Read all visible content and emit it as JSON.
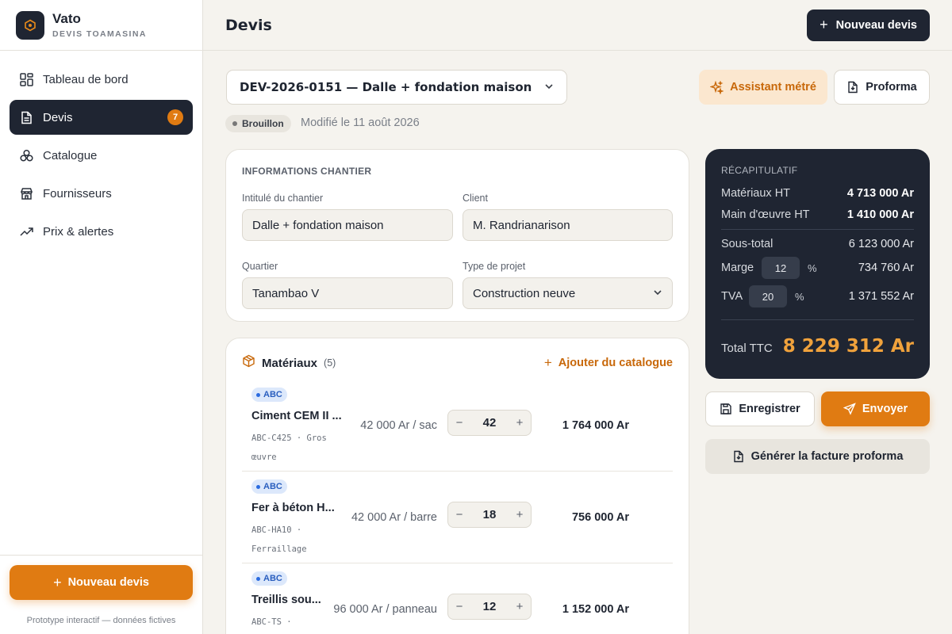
{
  "brand": {
    "name": "Vato",
    "subtitle": "DEVIS TOAMASINA"
  },
  "sidebar": {
    "items": [
      {
        "label": "Tableau de bord",
        "icon": "dashboard-icon"
      },
      {
        "label": "Devis",
        "icon": "document-icon",
        "badge": "7",
        "active": true
      },
      {
        "label": "Catalogue",
        "icon": "catalog-icon"
      },
      {
        "label": "Fournisseurs",
        "icon": "store-icon"
      },
      {
        "label": "Prix & alertes",
        "icon": "trending-up-icon"
      }
    ],
    "new_button": "Nouveau devis",
    "note": "Prototype interactif — données fictives"
  },
  "header": {
    "title": "Devis",
    "new_button": "Nouveau devis"
  },
  "devis": {
    "selected": "DEV-2026-0151 — Dalle + fondation maison",
    "assistant_button": "Assistant métré",
    "proforma_button": "Proforma",
    "status": "Brouillon",
    "modified": "Modifié le 11 août 2026"
  },
  "info": {
    "title": "INFORMATIONS CHANTIER",
    "fields": [
      {
        "label": "Intitulé du chantier",
        "value": "Dalle + fondation maison"
      },
      {
        "label": "Client",
        "value": "M. Randrianarison"
      },
      {
        "label": "Quartier",
        "value": "Tanambao V"
      },
      {
        "label": "Type de projet",
        "value": "Construction neuve"
      }
    ]
  },
  "materials": {
    "title": "Matériaux",
    "count": "(5)",
    "add_button": "Ajouter du catalogue",
    "rows": [
      {
        "badge": "ABC",
        "name": "Ciment CEM II ...",
        "code": "ABC-C425 · Gros œuvre",
        "price": "42 000 Ar",
        "unit": "/ sac",
        "qty": "42",
        "total": "1 764 000 Ar"
      },
      {
        "badge": "ABC",
        "name": "Fer à béton H...",
        "code": "ABC-HA10 · Ferraillage",
        "price": "42 000 Ar",
        "unit": "/ barre",
        "qty": "18",
        "total": "756 000 Ar"
      },
      {
        "badge": "ABC",
        "name": "Treillis sou...",
        "code": "ABC-TS ·",
        "price": "96 000 Ar",
        "unit": "/ panneau",
        "qty": "12",
        "total": "1 152 000 Ar"
      }
    ]
  },
  "recap": {
    "title": "RÉCAPITULATIF",
    "materiaux_label": "Matériaux HT",
    "materiaux_value": "4 713 000 Ar",
    "main_label": "Main d'œuvre HT",
    "main_value": "1 410 000 Ar",
    "sous_total_label": "Sous-total",
    "sous_total_value": "6 123 000 Ar",
    "marge_label": "Marge",
    "marge_pct": "12",
    "marge_value": "734 760 Ar",
    "tva_label": "TVA",
    "tva_pct": "20",
    "tva_value": "1 371 552 Ar",
    "pct_sign": "%",
    "total_label": "Total TTC",
    "total_value": "8 229 312 Ar"
  },
  "actions": {
    "save": "Enregistrer",
    "send": "Envoyer",
    "generate": "Générer la facture proforma"
  },
  "colors": {
    "accent": "#e07b12",
    "dark": "#1f2532",
    "total": "#f0a23c"
  }
}
